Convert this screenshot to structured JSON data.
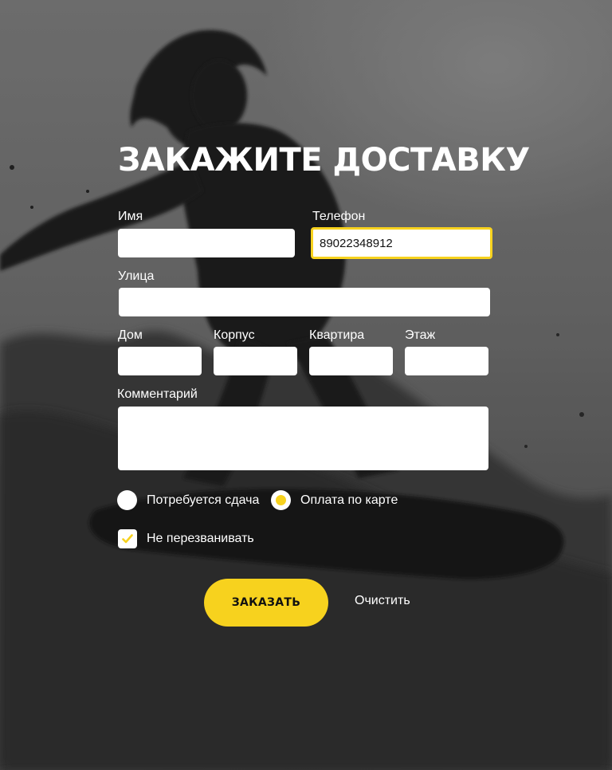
{
  "form": {
    "title": "ЗАКАЖИТЕ ДОСТАВКУ",
    "fields": {
      "name": {
        "label": "Имя",
        "value": ""
      },
      "phone": {
        "label": "Телефон",
        "value": "89022348912"
      },
      "street": {
        "label": "Улица",
        "value": ""
      },
      "house": {
        "label": "Дом",
        "value": ""
      },
      "building": {
        "label": "Корпус",
        "value": ""
      },
      "apartment": {
        "label": "Квартира",
        "value": ""
      },
      "floor": {
        "label": "Этаж",
        "value": ""
      },
      "comment": {
        "label": "Комментарий",
        "value": ""
      }
    },
    "payment": {
      "options": [
        {
          "label": "Потребуется сдача",
          "selected": false
        },
        {
          "label": "Оплата по карте",
          "selected": true
        }
      ]
    },
    "no_callback": {
      "label": "Не перезванивать",
      "checked": true
    },
    "submit_label": "ЗАКАЗАТЬ",
    "clear_label": "Очистить"
  },
  "colors": {
    "accent": "#f7d21e",
    "text": "#ffffff",
    "field": "#ffffff"
  },
  "icons": {
    "checkbox_mark": "check-icon",
    "background": "surfer-photo"
  }
}
